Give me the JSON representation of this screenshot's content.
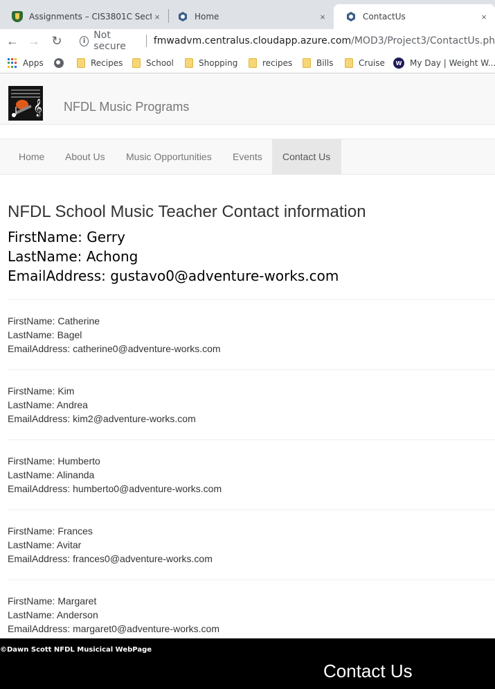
{
  "browser": {
    "tabs": [
      {
        "title": "Assignments – CIS3801C Section",
        "icon": "shield-favicon",
        "active": false
      },
      {
        "title": "Home",
        "icon": "hexagon-favicon",
        "active": false
      },
      {
        "title": "ContactUs",
        "icon": "hexagon-favicon",
        "active": true
      }
    ],
    "tab_close_glyph": "×",
    "toolbar": {
      "back_glyph": "←",
      "forward_glyph": "→",
      "reload_glyph": "↻",
      "security_text": "Not secure",
      "url_host": "fmwadvm.centralus.cloudapp.azure.com",
      "url_path": "/MOD3/Project3/ContactUs.php"
    },
    "bookmarks": [
      {
        "label": "Apps",
        "icon": "apps-grid-icon"
      },
      {
        "label": "",
        "icon": "globe-icon"
      },
      {
        "label": "Recipes",
        "icon": "folder-icon"
      },
      {
        "label": "School",
        "icon": "folder-icon"
      },
      {
        "label": "Shopping",
        "icon": "folder-icon"
      },
      {
        "label": "recipes",
        "icon": "folder-icon"
      },
      {
        "label": "Bills",
        "icon": "folder-icon"
      },
      {
        "label": "Cruise",
        "icon": "folder-icon"
      },
      {
        "label": "My Day | Weight W...",
        "icon": "weight-watchers-icon"
      }
    ]
  },
  "site": {
    "title": "NFDL Music Programs",
    "nav": [
      {
        "label": "Home",
        "active": false
      },
      {
        "label": "About Us",
        "active": false
      },
      {
        "label": "Music Opportunities",
        "active": false
      },
      {
        "label": "Events",
        "active": false
      },
      {
        "label": "Contact Us",
        "active": true
      }
    ]
  },
  "content": {
    "heading": "NFDL School Music Teacher Contact information",
    "featured": {
      "first": "FirstName: Gerry",
      "last": "LastName: Achong",
      "email": "EmailAddress: gustavo0@adventure-works.com"
    },
    "contacts": [
      {
        "first": "FirstName: Catherine",
        "last": "LastName: Bagel",
        "email": "EmailAddress: catherine0@adventure-works.com"
      },
      {
        "first": "FirstName: Kim",
        "last": "LastName: Andrea",
        "email": "EmailAddress: kim2@adventure-works.com"
      },
      {
        "first": "FirstName: Humberto",
        "last": "LastName: Alinanda",
        "email": "EmailAddress: humberto0@adventure-works.com"
      },
      {
        "first": "FirstName: Frances",
        "last": "LastName: Avitar",
        "email": "EmailAddress: frances0@adventure-works.com"
      },
      {
        "first": "FirstName: Margaret",
        "last": "LastName: Anderson",
        "email": "EmailAddress: margaret0@adventure-works.com"
      }
    ]
  },
  "footer": {
    "copyright": "©Dawn Scott NFDL Musicical WebPage",
    "title": "Contact Us"
  }
}
